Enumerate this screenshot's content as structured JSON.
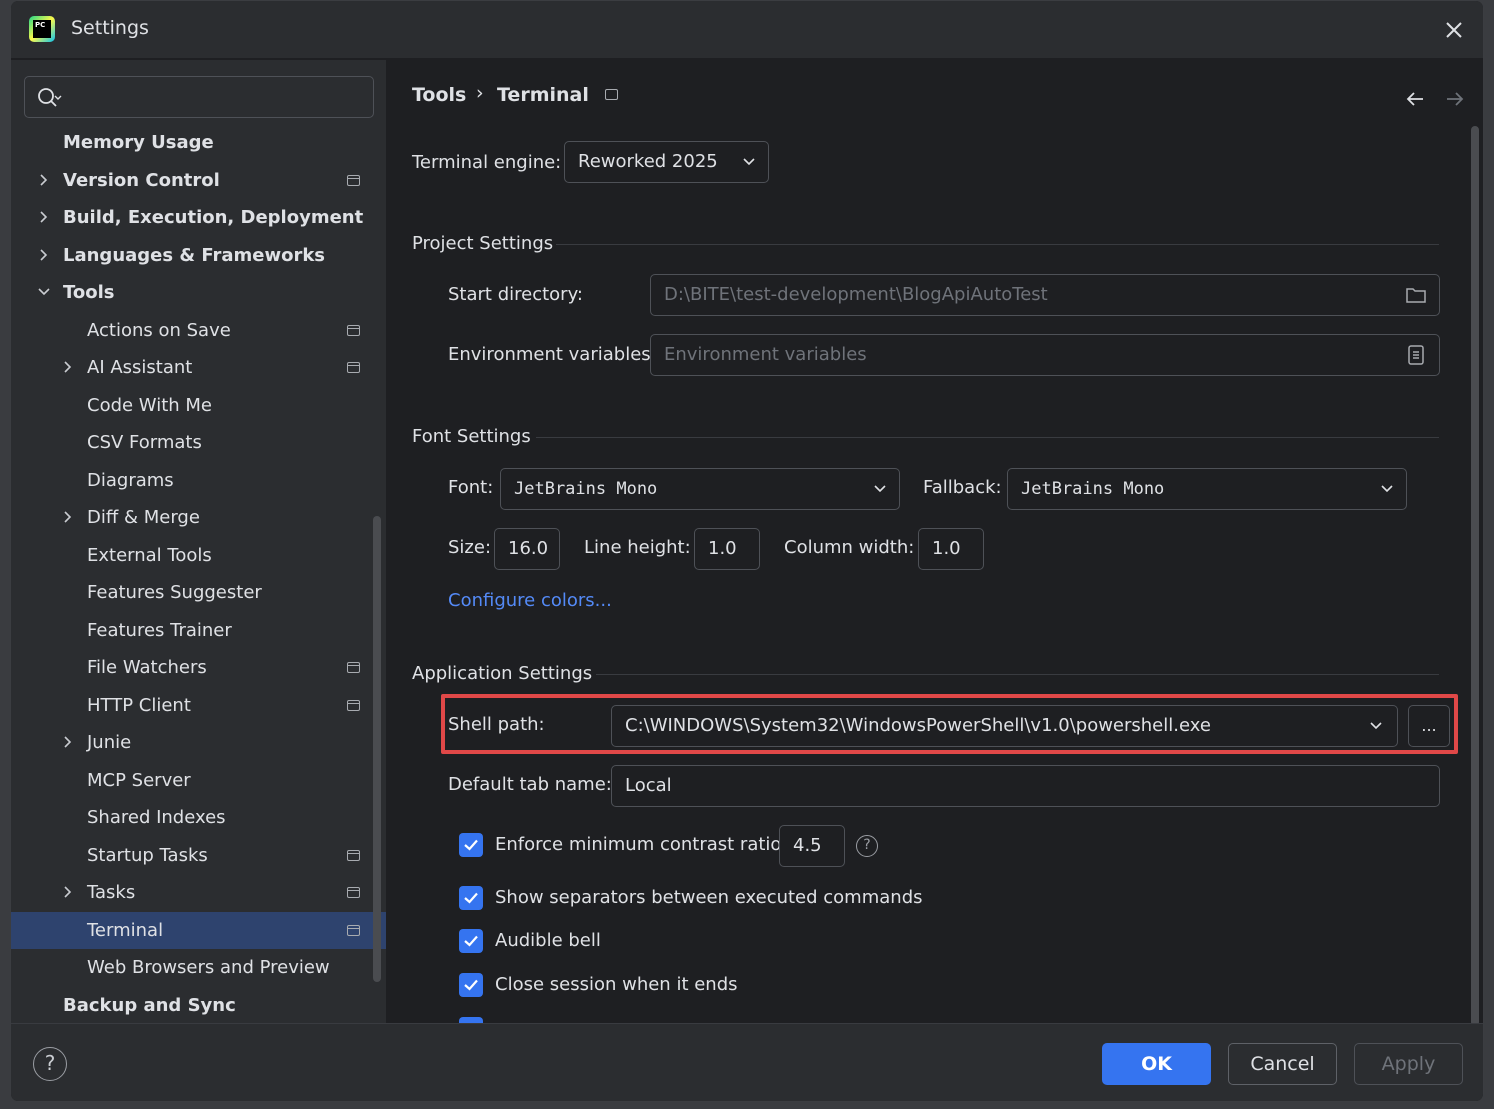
{
  "window": {
    "title": "Settings",
    "app_icon_text": "PC"
  },
  "sidebar": {
    "search": {
      "value": "",
      "placeholder": ""
    },
    "items": [
      {
        "label": "Memory Usage",
        "bold": true,
        "level": 0,
        "expander": "none",
        "pin": false,
        "selected": false
      },
      {
        "label": "Version Control",
        "bold": true,
        "level": 0,
        "expander": "collapsed",
        "pin": true,
        "selected": false
      },
      {
        "label": "Build, Execution, Deployment",
        "bold": true,
        "level": 0,
        "expander": "collapsed",
        "pin": false,
        "selected": false
      },
      {
        "label": "Languages & Frameworks",
        "bold": true,
        "level": 0,
        "expander": "collapsed",
        "pin": false,
        "selected": false
      },
      {
        "label": "Tools",
        "bold": true,
        "level": 0,
        "expander": "expanded",
        "pin": false,
        "selected": false
      },
      {
        "label": "Actions on Save",
        "bold": false,
        "level": 1,
        "expander": "none",
        "pin": true,
        "selected": false
      },
      {
        "label": "AI Assistant",
        "bold": false,
        "level": 1,
        "expander": "collapsed",
        "pin": true,
        "selected": false
      },
      {
        "label": "Code With Me",
        "bold": false,
        "level": 1,
        "expander": "none",
        "pin": false,
        "selected": false
      },
      {
        "label": "CSV Formats",
        "bold": false,
        "level": 1,
        "expander": "none",
        "pin": false,
        "selected": false
      },
      {
        "label": "Diagrams",
        "bold": false,
        "level": 1,
        "expander": "none",
        "pin": false,
        "selected": false
      },
      {
        "label": "Diff & Merge",
        "bold": false,
        "level": 1,
        "expander": "collapsed",
        "pin": false,
        "selected": false
      },
      {
        "label": "External Tools",
        "bold": false,
        "level": 1,
        "expander": "none",
        "pin": false,
        "selected": false
      },
      {
        "label": "Features Suggester",
        "bold": false,
        "level": 1,
        "expander": "none",
        "pin": false,
        "selected": false
      },
      {
        "label": "Features Trainer",
        "bold": false,
        "level": 1,
        "expander": "none",
        "pin": false,
        "selected": false
      },
      {
        "label": "File Watchers",
        "bold": false,
        "level": 1,
        "expander": "none",
        "pin": true,
        "selected": false
      },
      {
        "label": "HTTP Client",
        "bold": false,
        "level": 1,
        "expander": "none",
        "pin": true,
        "selected": false
      },
      {
        "label": "Junie",
        "bold": false,
        "level": 1,
        "expander": "collapsed",
        "pin": false,
        "selected": false
      },
      {
        "label": "MCP Server",
        "bold": false,
        "level": 1,
        "expander": "none",
        "pin": false,
        "selected": false
      },
      {
        "label": "Shared Indexes",
        "bold": false,
        "level": 1,
        "expander": "none",
        "pin": false,
        "selected": false
      },
      {
        "label": "Startup Tasks",
        "bold": false,
        "level": 1,
        "expander": "none",
        "pin": true,
        "selected": false
      },
      {
        "label": "Tasks",
        "bold": false,
        "level": 1,
        "expander": "collapsed",
        "pin": true,
        "selected": false
      },
      {
        "label": "Terminal",
        "bold": false,
        "level": 1,
        "expander": "none",
        "pin": true,
        "selected": true
      },
      {
        "label": "Web Browsers and Preview",
        "bold": false,
        "level": 1,
        "expander": "none",
        "pin": false,
        "selected": false
      },
      {
        "label": "Backup and Sync",
        "bold": true,
        "level": 0,
        "expander": "none",
        "pin": false,
        "selected": false
      }
    ]
  },
  "breadcrumb": {
    "parent": "Tools",
    "separator": "›",
    "current": "Terminal"
  },
  "engine": {
    "label": "Terminal engine:",
    "value": "Reworked 2025"
  },
  "project_settings": {
    "title": "Project Settings",
    "start_directory": {
      "label": "Start directory:",
      "value": "D:\\BITE\\test-development\\BlogApiAutoTest"
    },
    "env_vars": {
      "label": "Environment variables:",
      "placeholder": "Environment variables"
    }
  },
  "font_settings": {
    "title": "Font Settings",
    "font": {
      "label": "Font:",
      "value": "JetBrains Mono"
    },
    "fallback": {
      "label": "Fallback:",
      "value": "JetBrains Mono"
    },
    "size": {
      "label": "Size:",
      "value": "16.0"
    },
    "line_height": {
      "label": "Line height:",
      "value": "1.0"
    },
    "column_width": {
      "label": "Column width:",
      "value": "1.0"
    },
    "configure_colors": "Configure colors..."
  },
  "application_settings": {
    "title": "Application Settings",
    "shell_path": {
      "label": "Shell path:",
      "value": "C:\\WINDOWS\\System32\\WindowsPowerShell\\v1.0\\powershell.exe",
      "browse": "..."
    },
    "default_tab": {
      "label": "Default tab name:",
      "value": "Local"
    },
    "contrast": {
      "label": "Enforce minimum contrast ratio:",
      "value": "4.5",
      "checked": true
    },
    "separators": {
      "label": "Show separators between executed commands",
      "checked": true
    },
    "audible_bell": {
      "label": "Audible bell",
      "checked": true
    },
    "close_session": {
      "label": "Close session when it ends",
      "checked": true
    }
  },
  "footer": {
    "help": "?",
    "ok": "OK",
    "cancel": "Cancel",
    "apply": "Apply"
  },
  "colors": {
    "accent": "#3574f0",
    "highlight": "#e04848",
    "link": "#548af7",
    "selection": "#2e436e"
  }
}
